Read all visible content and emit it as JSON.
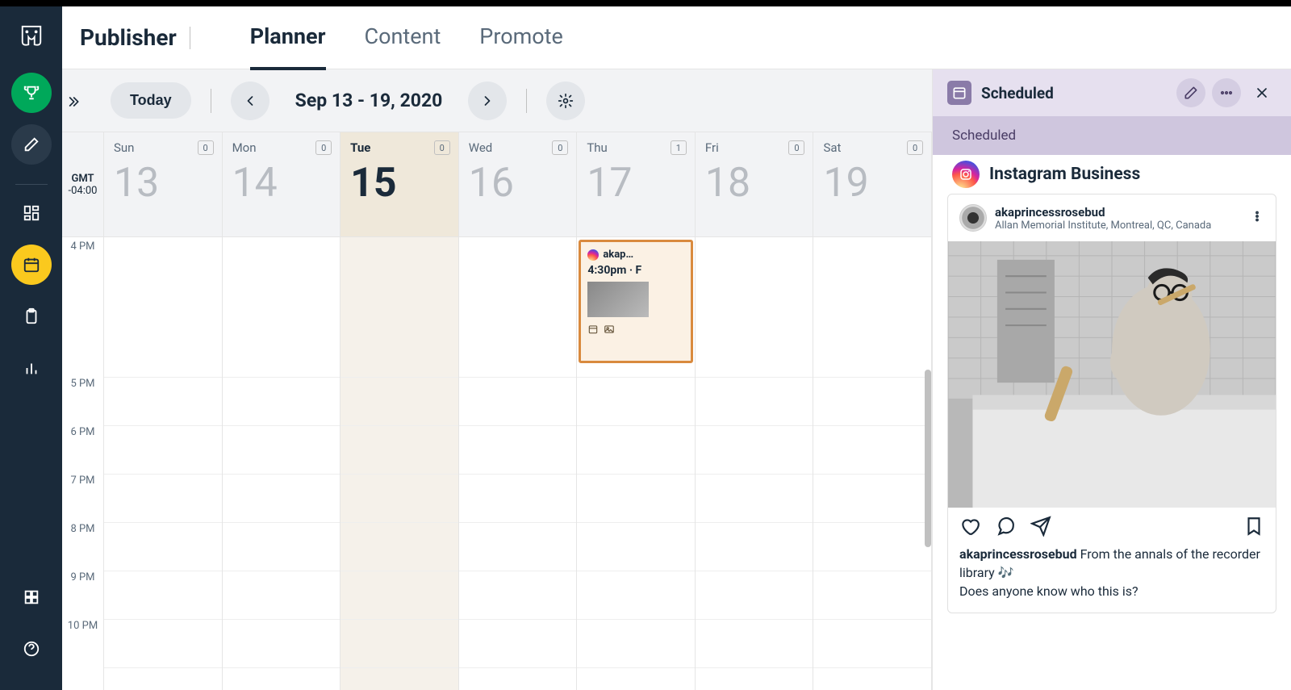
{
  "app": {
    "title": "Publisher",
    "tabs": [
      {
        "label": "Planner",
        "active": true
      },
      {
        "label": "Content",
        "active": false
      },
      {
        "label": "Promote",
        "active": false
      }
    ]
  },
  "toolbar": {
    "today_label": "Today",
    "date_range": "Sep 13 - 19, 2020"
  },
  "timezone": {
    "line1": "GMT",
    "line2": "-04:00"
  },
  "days": [
    {
      "name": "Sun",
      "num": "13",
      "count": "0",
      "today": false
    },
    {
      "name": "Mon",
      "num": "14",
      "count": "0",
      "today": false
    },
    {
      "name": "Tue",
      "num": "15",
      "count": "0",
      "today": true
    },
    {
      "name": "Wed",
      "num": "16",
      "count": "0",
      "today": false
    },
    {
      "name": "Thu",
      "num": "17",
      "count": "1",
      "today": false
    },
    {
      "name": "Fri",
      "num": "18",
      "count": "0",
      "today": false
    },
    {
      "name": "Sat",
      "num": "19",
      "count": "0",
      "today": false
    }
  ],
  "time_slots": [
    "4 PM",
    "5 PM",
    "6 PM",
    "7 PM",
    "8 PM",
    "9 PM",
    "10 PM"
  ],
  "event": {
    "account": "akap…",
    "time_text": "4:30pm · F"
  },
  "side": {
    "header_title": "Scheduled",
    "subheader": "Scheduled",
    "network": "Instagram Business"
  },
  "post": {
    "username": "akaprincessrosebud",
    "location": "Allan Memorial Institute, Montreal, QC, Canada",
    "caption_user": "akaprincessrosebud",
    "caption_text1": "  From the annals of the recorder library 🎶",
    "caption_text2": "Does anyone know who this is?"
  }
}
